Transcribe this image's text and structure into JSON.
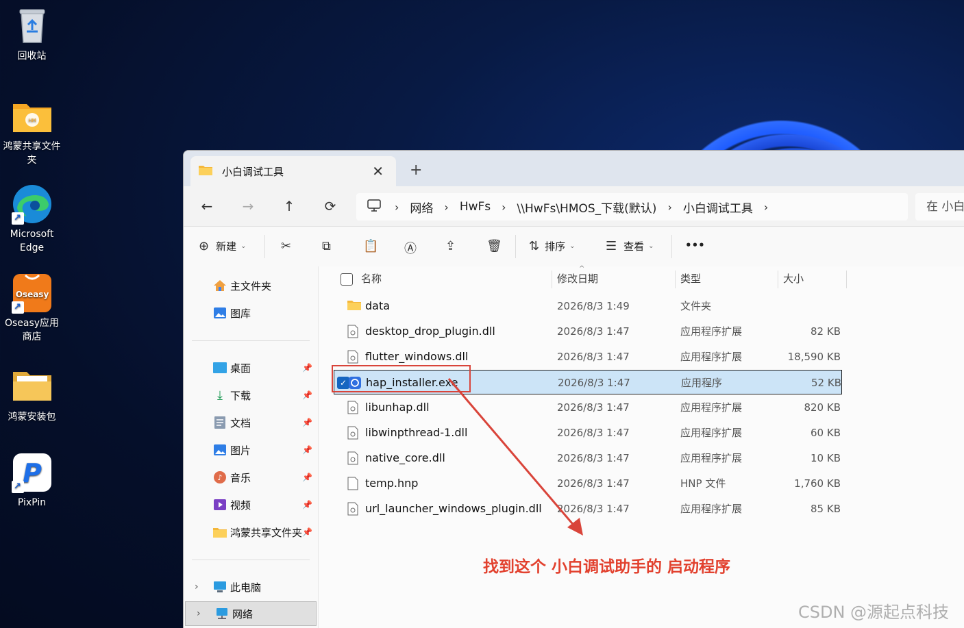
{
  "desktop": {
    "icons": [
      {
        "label": "回收站",
        "icon": "recycle-bin-icon"
      },
      {
        "label": "鸿蒙共享文件夹",
        "icon": "folder-icon"
      },
      {
        "label": "Microsoft Edge",
        "icon": "edge-icon"
      },
      {
        "label": "Oseasy应用商店",
        "icon": "oseasy-icon",
        "badge": "Oseasy"
      },
      {
        "label": "鸿蒙安装包",
        "icon": "folder-icon"
      },
      {
        "label": "PixPin",
        "icon": "pixpin-icon"
      }
    ]
  },
  "explorer": {
    "tab_title": "小白调试工具",
    "new_tab": "+",
    "close": "✕",
    "breadcrumb": [
      "网络",
      "HwFs",
      "\\\\HwFs\\HMOS_下载(默认)",
      "小白调试工具"
    ],
    "search_placeholder": "在 小白",
    "toolbar": {
      "new": "新建",
      "sort": "排序",
      "view": "查看",
      "more": "•••"
    },
    "sidebar": {
      "home": "主文件夹",
      "gallery": "图库",
      "desktop": "桌面",
      "downloads": "下载",
      "documents": "文档",
      "pictures": "图片",
      "music": "音乐",
      "videos": "视频",
      "shared": "鸿蒙共享文件夹",
      "this_pc": "此电脑",
      "network": "网络"
    },
    "columns": {
      "name": "名称",
      "modified": "修改日期",
      "type": "类型",
      "size": "大小"
    },
    "files": [
      {
        "name": "data",
        "date": "2026/8/3 1:49",
        "type": "文件夹",
        "size": ""
      },
      {
        "name": "desktop_drop_plugin.dll",
        "date": "2026/8/3 1:47",
        "type": "应用程序扩展",
        "size": "82 KB"
      },
      {
        "name": "flutter_windows.dll",
        "date": "2026/8/3 1:47",
        "type": "应用程序扩展",
        "size": "18,590 KB"
      },
      {
        "name": "hap_installer.exe",
        "date": "2026/8/3 1:47",
        "type": "应用程序",
        "size": "52 KB"
      },
      {
        "name": "libunhap.dll",
        "date": "2026/8/3 1:47",
        "type": "应用程序扩展",
        "size": "820 KB"
      },
      {
        "name": "libwinpthread-1.dll",
        "date": "2026/8/3 1:47",
        "type": "应用程序扩展",
        "size": "60 KB"
      },
      {
        "name": "native_core.dll",
        "date": "2026/8/3 1:47",
        "type": "应用程序扩展",
        "size": "10 KB"
      },
      {
        "name": "temp.hnp",
        "date": "2026/8/3 1:47",
        "type": "HNP 文件",
        "size": "1,760 KB"
      },
      {
        "name": "url_launcher_windows_plugin.dll",
        "date": "2026/8/3 1:47",
        "type": "应用程序扩展",
        "size": "85 KB"
      }
    ]
  },
  "annotation": "找到这个 小白调试助手的 启动程序",
  "watermark": "CSDN @源起点科技",
  "colors": {
    "annotation": "#e2412e",
    "selection": "#cce4f7",
    "accent": "#1565c0"
  }
}
